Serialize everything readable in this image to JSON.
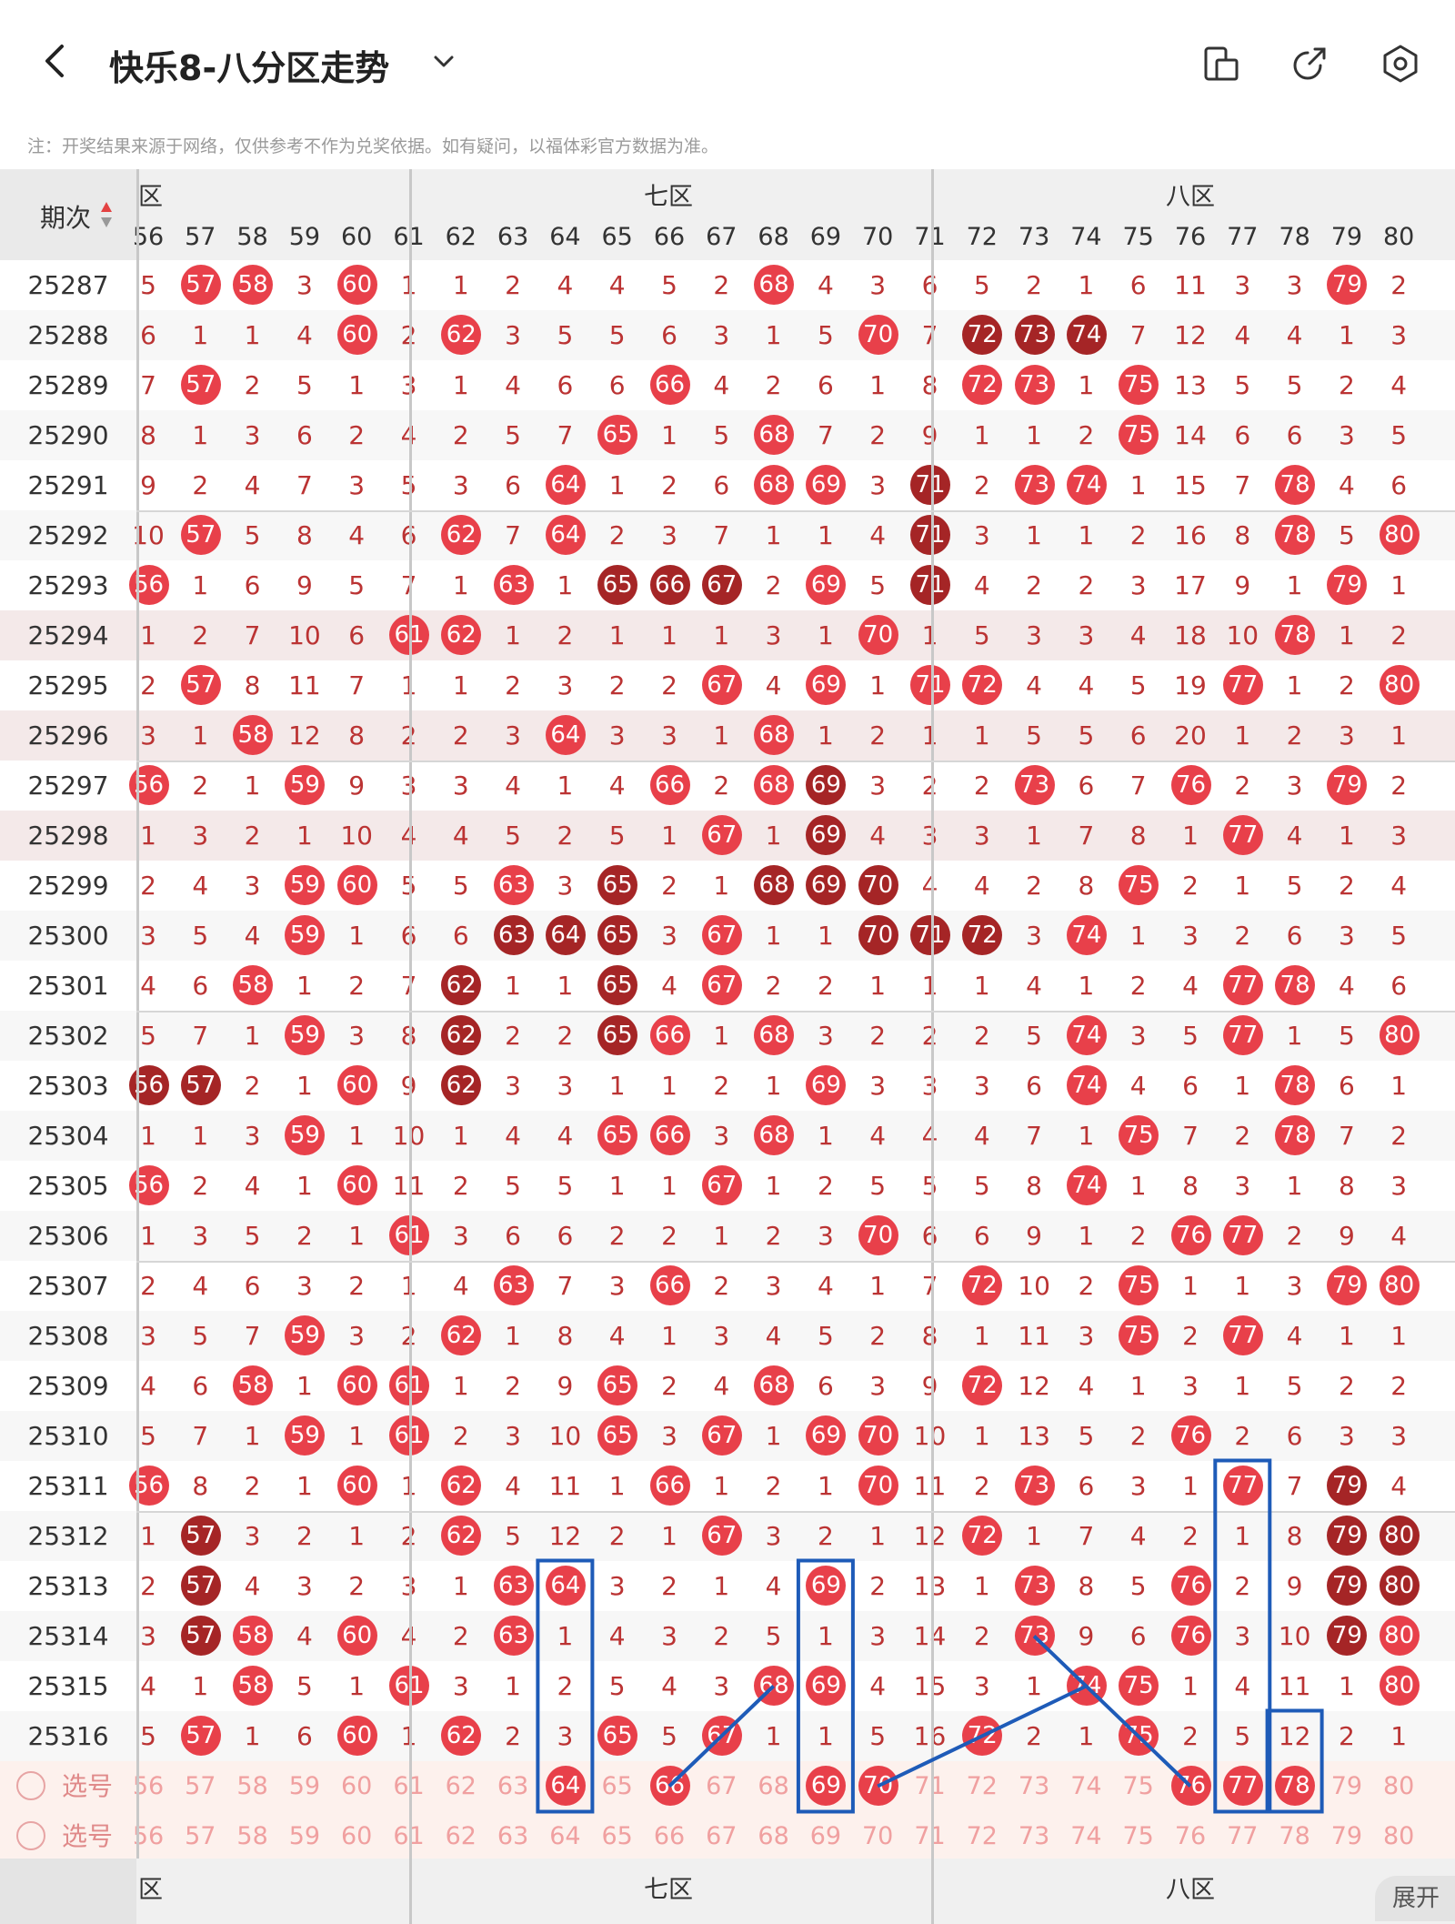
{
  "header": {
    "title": "快乐8-八分区走势",
    "back_icon": "chevron-left-icon",
    "dropdown_icon": "chevron-down-icon",
    "actions": [
      "screen-toggle-icon",
      "share-icon",
      "settings-icon"
    ]
  },
  "note": "注：开奖结果来源于网络，仅供参考不作为兑奖依据。如有疑问，以福体彩官方数据为准。",
  "table": {
    "period_header": "期次",
    "zones": [
      {
        "label": "六区",
        "partial": "区"
      },
      {
        "label": "七区"
      },
      {
        "label": "八区"
      }
    ],
    "columns": [
      56,
      57,
      58,
      59,
      60,
      61,
      62,
      63,
      64,
      65,
      66,
      67,
      68,
      69,
      70,
      71,
      72,
      73,
      74,
      75,
      76,
      77,
      78,
      79,
      80
    ],
    "rows": [
      {
        "period": "25287",
        "cells": [
          "5",
          "57",
          "58",
          "3",
          "60",
          "1",
          "1",
          "2",
          "4",
          "4",
          "5",
          "2",
          "68",
          "4",
          "3",
          "6",
          "5",
          "2",
          "1",
          "6",
          "11",
          "3",
          "3",
          "79",
          "2"
        ]
      },
      {
        "period": "25288",
        "cells": [
          "6",
          "1",
          "1",
          "4",
          "60",
          "2",
          "62",
          "3",
          "5",
          "5",
          "6",
          "3",
          "1",
          "5",
          "70",
          "7",
          "D72",
          "D73",
          "D74",
          "7",
          "12",
          "4",
          "4",
          "1",
          "3"
        ]
      },
      {
        "period": "25289",
        "cells": [
          "7",
          "57",
          "2",
          "5",
          "1",
          "3",
          "1",
          "4",
          "6",
          "6",
          "66",
          "4",
          "2",
          "6",
          "1",
          "8",
          "72",
          "73",
          "1",
          "75",
          "13",
          "5",
          "5",
          "2",
          "4"
        ]
      },
      {
        "period": "25290",
        "cells": [
          "8",
          "1",
          "3",
          "6",
          "2",
          "4",
          "2",
          "5",
          "7",
          "65",
          "1",
          "5",
          "68",
          "7",
          "2",
          "9",
          "1",
          "1",
          "2",
          "75",
          "14",
          "6",
          "6",
          "3",
          "5"
        ]
      },
      {
        "period": "25291",
        "cells": [
          "9",
          "2",
          "4",
          "7",
          "3",
          "5",
          "3",
          "6",
          "64",
          "1",
          "2",
          "6",
          "68",
          "69",
          "3",
          "D71",
          "2",
          "73",
          "74",
          "1",
          "15",
          "7",
          "78",
          "4",
          "6"
        ]
      },
      {
        "period": "25292",
        "cells": [
          "10",
          "57",
          "5",
          "8",
          "4",
          "6",
          "62",
          "7",
          "64",
          "2",
          "3",
          "7",
          "1",
          "1",
          "4",
          "D71",
          "3",
          "1",
          "1",
          "2",
          "16",
          "8",
          "78",
          "5",
          "80"
        ]
      },
      {
        "period": "25293",
        "cells": [
          "56",
          "1",
          "6",
          "9",
          "5",
          "7",
          "1",
          "63",
          "1",
          "D65",
          "D66",
          "D67",
          "2",
          "69",
          "5",
          "D71",
          "4",
          "2",
          "2",
          "3",
          "17",
          "9",
          "1",
          "79",
          "1"
        ]
      },
      {
        "period": "25294",
        "cells": [
          "1",
          "2",
          "7",
          "10",
          "6",
          "61",
          "62",
          "1",
          "2",
          "1",
          "1",
          "1",
          "3",
          "1",
          "70",
          "1",
          "5",
          "3",
          "3",
          "4",
          "18",
          "10",
          "78",
          "1",
          "2"
        ]
      },
      {
        "period": "25295",
        "cells": [
          "2",
          "57",
          "8",
          "11",
          "7",
          "1",
          "1",
          "2",
          "3",
          "2",
          "2",
          "67",
          "4",
          "69",
          "1",
          "71",
          "72",
          "4",
          "4",
          "5",
          "19",
          "77",
          "1",
          "2",
          "80"
        ]
      },
      {
        "period": "25296",
        "cells": [
          "3",
          "1",
          "58",
          "12",
          "8",
          "2",
          "2",
          "3",
          "64",
          "3",
          "3",
          "1",
          "68",
          "1",
          "2",
          "1",
          "1",
          "5",
          "5",
          "6",
          "20",
          "1",
          "2",
          "3",
          "1"
        ]
      },
      {
        "period": "25297",
        "cells": [
          "56",
          "2",
          "1",
          "59",
          "9",
          "3",
          "3",
          "4",
          "1",
          "4",
          "66",
          "2",
          "68",
          "D69",
          "3",
          "2",
          "2",
          "73",
          "6",
          "7",
          "76",
          "2",
          "3",
          "79",
          "2"
        ]
      },
      {
        "period": "25298",
        "cells": [
          "1",
          "3",
          "2",
          "1",
          "10",
          "4",
          "4",
          "5",
          "2",
          "5",
          "1",
          "67",
          "1",
          "D69",
          "4",
          "3",
          "3",
          "1",
          "7",
          "8",
          "1",
          "77",
          "4",
          "1",
          "3"
        ]
      },
      {
        "period": "25299",
        "cells": [
          "2",
          "4",
          "3",
          "59",
          "60",
          "5",
          "5",
          "63",
          "3",
          "D65",
          "2",
          "1",
          "D68",
          "D69",
          "D70",
          "4",
          "4",
          "2",
          "8",
          "75",
          "2",
          "1",
          "5",
          "2",
          "4"
        ]
      },
      {
        "period": "25300",
        "cells": [
          "3",
          "5",
          "4",
          "59",
          "1",
          "6",
          "6",
          "D63",
          "D64",
          "D65",
          "3",
          "67",
          "1",
          "1",
          "D70",
          "D71",
          "D72",
          "3",
          "74",
          "1",
          "3",
          "2",
          "6",
          "3",
          "5"
        ]
      },
      {
        "period": "25301",
        "cells": [
          "4",
          "6",
          "58",
          "1",
          "2",
          "7",
          "D62",
          "1",
          "1",
          "D65",
          "4",
          "67",
          "2",
          "2",
          "1",
          "1",
          "1",
          "4",
          "1",
          "2",
          "4",
          "77",
          "78",
          "4",
          "6"
        ]
      },
      {
        "period": "25302",
        "cells": [
          "5",
          "7",
          "1",
          "59",
          "3",
          "8",
          "D62",
          "2",
          "2",
          "D65",
          "66",
          "1",
          "68",
          "3",
          "2",
          "2",
          "2",
          "5",
          "74",
          "3",
          "5",
          "77",
          "1",
          "5",
          "80"
        ]
      },
      {
        "period": "25303",
        "cells": [
          "D56",
          "D57",
          "2",
          "1",
          "60",
          "9",
          "D62",
          "3",
          "3",
          "1",
          "1",
          "2",
          "1",
          "69",
          "3",
          "3",
          "3",
          "6",
          "74",
          "4",
          "6",
          "1",
          "78",
          "6",
          "1"
        ]
      },
      {
        "period": "25304",
        "cells": [
          "1",
          "1",
          "3",
          "59",
          "1",
          "10",
          "1",
          "4",
          "4",
          "65",
          "66",
          "3",
          "68",
          "1",
          "4",
          "4",
          "4",
          "7",
          "1",
          "75",
          "7",
          "2",
          "78",
          "7",
          "2"
        ]
      },
      {
        "period": "25305",
        "cells": [
          "56",
          "2",
          "4",
          "1",
          "60",
          "11",
          "2",
          "5",
          "5",
          "1",
          "1",
          "67",
          "1",
          "2",
          "5",
          "5",
          "5",
          "8",
          "74",
          "1",
          "8",
          "3",
          "1",
          "8",
          "3"
        ]
      },
      {
        "period": "25306",
        "cells": [
          "1",
          "3",
          "5",
          "2",
          "1",
          "61",
          "3",
          "6",
          "6",
          "2",
          "2",
          "1",
          "2",
          "3",
          "70",
          "6",
          "6",
          "9",
          "1",
          "2",
          "76",
          "77",
          "2",
          "9",
          "4"
        ]
      },
      {
        "period": "25307",
        "cells": [
          "2",
          "4",
          "6",
          "3",
          "2",
          "1",
          "4",
          "63",
          "7",
          "3",
          "66",
          "2",
          "3",
          "4",
          "1",
          "7",
          "72",
          "10",
          "2",
          "75",
          "1",
          "1",
          "3",
          "79",
          "80"
        ]
      },
      {
        "period": "25308",
        "cells": [
          "3",
          "5",
          "7",
          "59",
          "3",
          "2",
          "62",
          "1",
          "8",
          "4",
          "1",
          "3",
          "4",
          "5",
          "2",
          "8",
          "1",
          "11",
          "3",
          "75",
          "2",
          "77",
          "4",
          "1",
          "1"
        ]
      },
      {
        "period": "25309",
        "cells": [
          "4",
          "6",
          "58",
          "1",
          "60",
          "61",
          "1",
          "2",
          "9",
          "65",
          "2",
          "4",
          "68",
          "6",
          "3",
          "9",
          "72",
          "12",
          "4",
          "1",
          "3",
          "1",
          "5",
          "2",
          "2"
        ]
      },
      {
        "period": "25310",
        "cells": [
          "5",
          "7",
          "1",
          "59",
          "1",
          "61",
          "2",
          "3",
          "10",
          "65",
          "3",
          "67",
          "1",
          "69",
          "70",
          "10",
          "1",
          "13",
          "5",
          "2",
          "76",
          "2",
          "6",
          "3",
          "3"
        ]
      },
      {
        "period": "25311",
        "cells": [
          "56",
          "8",
          "2",
          "1",
          "60",
          "1",
          "62",
          "4",
          "11",
          "1",
          "66",
          "1",
          "2",
          "1",
          "70",
          "11",
          "2",
          "73",
          "6",
          "3",
          "1",
          "77",
          "7",
          "D79",
          "4"
        ]
      },
      {
        "period": "25312",
        "cells": [
          "1",
          "D57",
          "3",
          "2",
          "1",
          "2",
          "62",
          "5",
          "12",
          "2",
          "1",
          "67",
          "3",
          "2",
          "1",
          "12",
          "72",
          "1",
          "7",
          "4",
          "2",
          "1",
          "8",
          "D79",
          "D80"
        ]
      },
      {
        "period": "25313",
        "cells": [
          "2",
          "D57",
          "4",
          "3",
          "2",
          "3",
          "1",
          "63",
          "64",
          "3",
          "2",
          "1",
          "4",
          "69",
          "2",
          "13",
          "1",
          "73",
          "8",
          "5",
          "76",
          "2",
          "9",
          "D79",
          "D80"
        ]
      },
      {
        "period": "25314",
        "cells": [
          "3",
          "D57",
          "58",
          "4",
          "60",
          "4",
          "2",
          "63",
          "1",
          "4",
          "3",
          "2",
          "5",
          "1",
          "3",
          "14",
          "2",
          "73",
          "9",
          "6",
          "76",
          "3",
          "10",
          "D79",
          "80"
        ]
      },
      {
        "period": "25315",
        "cells": [
          "4",
          "1",
          "58",
          "5",
          "1",
          "61",
          "3",
          "1",
          "2",
          "5",
          "4",
          "3",
          "68",
          "69",
          "4",
          "15",
          "3",
          "1",
          "74",
          "75",
          "1",
          "4",
          "11",
          "1",
          "80"
        ]
      },
      {
        "period": "25316",
        "cells": [
          "5",
          "57",
          "1",
          "6",
          "60",
          "1",
          "62",
          "2",
          "3",
          "65",
          "5",
          "67",
          "1",
          "1",
          "5",
          "16",
          "72",
          "2",
          "1",
          "75",
          "2",
          "5",
          "12",
          "2",
          "1"
        ]
      }
    ],
    "selection_rows": [
      {
        "label": "选号",
        "selected": [
          64,
          66,
          69,
          70,
          76,
          77,
          78
        ]
      },
      {
        "label": "选号",
        "selected": []
      }
    ],
    "footer_zones": [
      "区",
      "七区",
      "八区"
    ]
  },
  "expand_label": "展开",
  "colors": {
    "ball": "#e8404a",
    "ball_dark": "#a52526",
    "miss_text": "#b33333",
    "annotation": "#1e5bb8"
  }
}
